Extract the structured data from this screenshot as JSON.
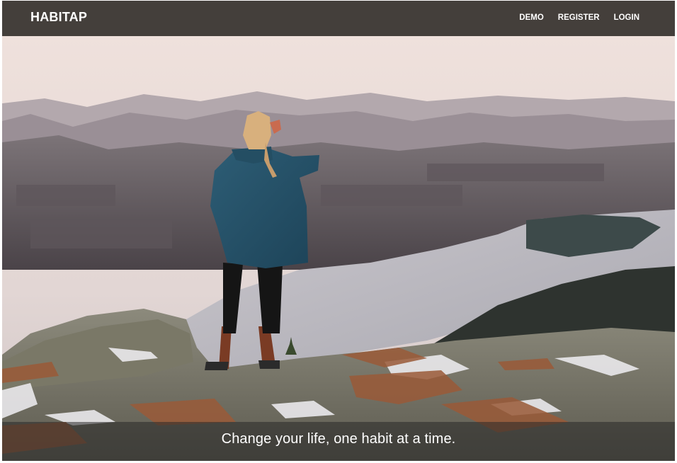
{
  "navbar": {
    "brand": "HABITAP",
    "links": [
      "DEMO",
      "REGISTER",
      "LOGIN"
    ]
  },
  "hero": {
    "tagline": "Change your life, one habit at a time."
  },
  "colors": {
    "navbar_bg": "#443f3b",
    "text": "#ffffff",
    "caption_overlay": "rgba(40,40,40,0.55)"
  }
}
